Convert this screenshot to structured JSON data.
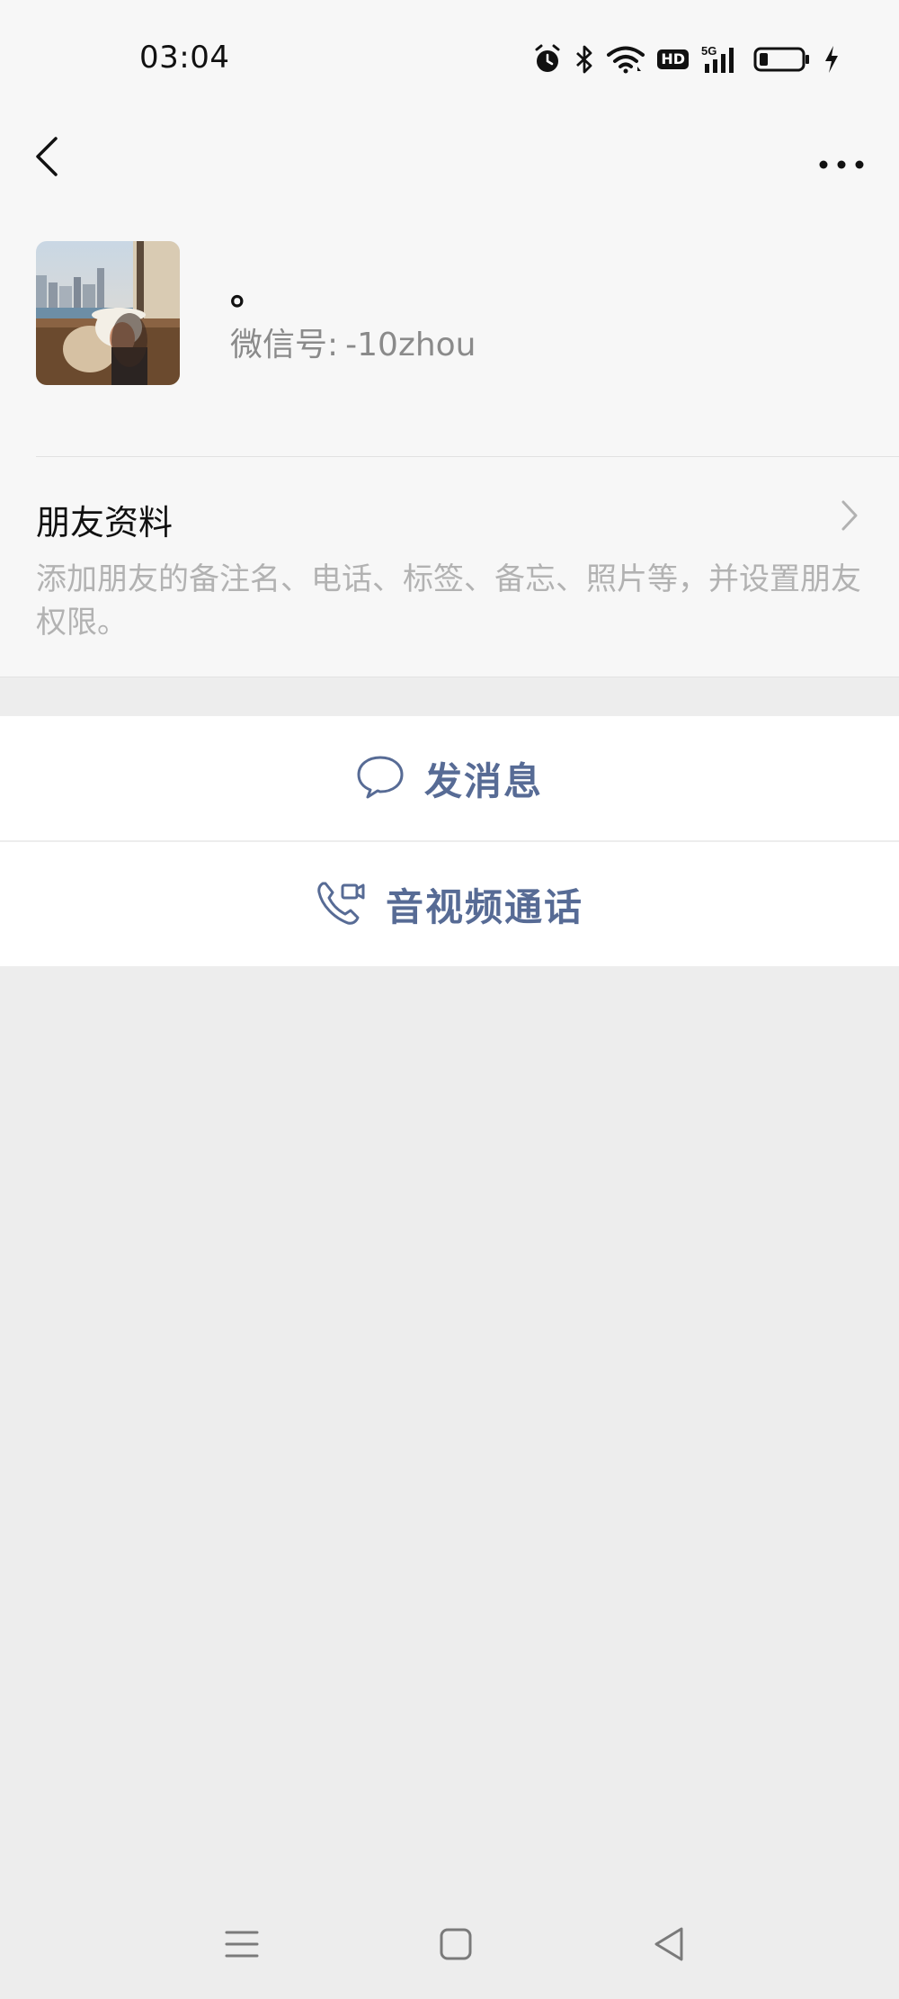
{
  "status_bar": {
    "time": "03:04",
    "icons": [
      "alarm-icon",
      "bluetooth-icon",
      "wifi-icon",
      "hd-icon",
      "5g-signal-icon",
      "battery-icon",
      "charging-icon"
    ],
    "hd_label": "HD",
    "network_label": "5G"
  },
  "nav": {
    "back_icon": "chevron-left-icon",
    "more_icon": "more-horizontal-icon"
  },
  "profile": {
    "nickname": "。",
    "wechat_id_label": "微信号:",
    "wechat_id_value": "-10zhou"
  },
  "friend_info": {
    "title": "朋友资料",
    "description": "添加朋友的备注名、电话、标签、备忘、照片等，并设置朋友权限。"
  },
  "actions": {
    "send_message": "发消息",
    "av_call": "音视频通话"
  },
  "colors": {
    "accent": "#576b95",
    "background": "#ededed",
    "card": "#f7f7f7"
  }
}
